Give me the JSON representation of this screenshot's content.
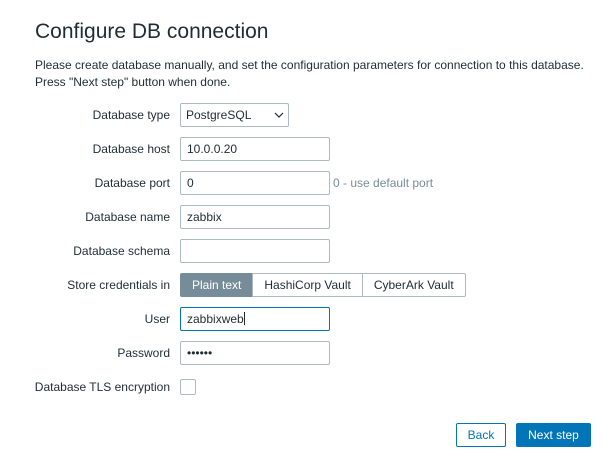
{
  "page": {
    "title": "Configure DB connection",
    "description_line1": "Please create database manually, and set the configuration parameters for connection to this database.",
    "description_line2": "Press \"Next step\" button when done."
  },
  "form": {
    "db_type": {
      "label": "Database type",
      "value": "PostgreSQL"
    },
    "db_host": {
      "label": "Database host",
      "value": "10.0.0.20"
    },
    "db_port": {
      "label": "Database port",
      "value": "0",
      "hint": "0 - use default port"
    },
    "db_name": {
      "label": "Database name",
      "value": "zabbix"
    },
    "db_schema": {
      "label": "Database schema",
      "value": ""
    },
    "store_credentials": {
      "label": "Store credentials in",
      "options": [
        "Plain text",
        "HashiCorp Vault",
        "CyberArk Vault"
      ],
      "selected": "Plain text"
    },
    "user": {
      "label": "User",
      "value": "zabbixweb"
    },
    "password": {
      "label": "Password",
      "value": "••••••"
    },
    "tls": {
      "label": "Database TLS encryption",
      "checked": false
    }
  },
  "buttons": {
    "back": "Back",
    "next": "Next step"
  },
  "colors": {
    "primary": "#0275b8",
    "segment_active": "#768d99",
    "hint": "#768d99",
    "border": "#acbbc2"
  }
}
